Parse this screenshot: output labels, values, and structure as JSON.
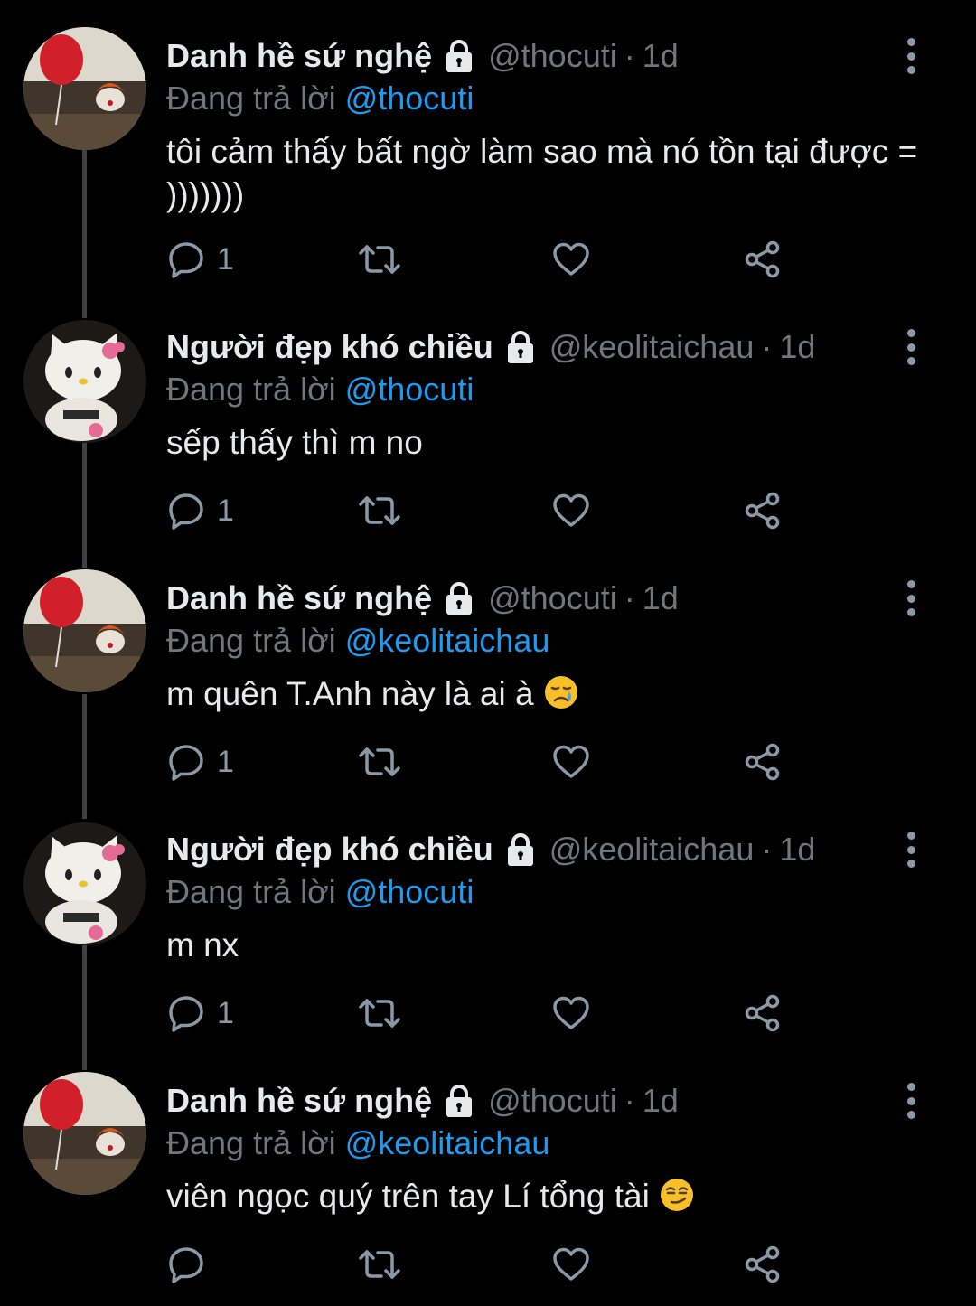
{
  "tweets": [
    {
      "name": "Danh hề sứ nghệ",
      "handle": "@thocuti",
      "separator": "·",
      "time": "1d",
      "replying_prefix": "Đang trả lời",
      "replying_to": "@thocuti",
      "text": "tôi cảm thấy bất ngờ làm sao mà nó tồn tại được = )))))))",
      "reply_count": "1",
      "avatar": "balloon-clown-avatar"
    },
    {
      "name": "Người đẹp khó chiều",
      "handle": "@keolitaichau",
      "separator": "·",
      "time": "1d",
      "replying_prefix": "Đang trả lời",
      "replying_to": "@thocuti",
      "text": "sếp thấy thì m no",
      "reply_count": "1",
      "avatar": "hello-kitty-avatar"
    },
    {
      "name": "Danh hề sứ nghệ",
      "handle": "@thocuti",
      "separator": "·",
      "time": "1d",
      "replying_prefix": "Đang trả lời",
      "replying_to": "@keolitaichau",
      "text": "m quên T.Anh này là ai à",
      "emoji": "sad-face-emoji",
      "reply_count": "1",
      "avatar": "balloon-clown-avatar"
    },
    {
      "name": "Người đẹp khó chiều",
      "handle": "@keolitaichau",
      "separator": "·",
      "time": "1d",
      "replying_prefix": "Đang trả lời",
      "replying_to": "@thocuti",
      "text": "m nx",
      "reply_count": "1",
      "avatar": "hello-kitty-avatar"
    },
    {
      "name": "Danh hề sứ nghệ",
      "handle": "@thocuti",
      "separator": "·",
      "time": "1d",
      "replying_prefix": "Đang trả lời",
      "replying_to": "@keolitaichau",
      "text": "viên ngọc quý trên tay Lí tổng tài",
      "emoji": "smirk-face-emoji",
      "reply_count": "",
      "avatar": "balloon-clown-avatar"
    }
  ],
  "colors": {
    "background": "#000000",
    "text": "#e7e9ea",
    "secondary": "#71767b",
    "mention": "#1d9bf0",
    "icon": "#8b98a5",
    "thread_line": "#3e4144"
  },
  "icons": {
    "lock": "lock-icon",
    "more": "more-vertical-icon",
    "reply": "reply-icon",
    "retweet": "retweet-icon",
    "like": "heart-icon",
    "share": "share-icon"
  }
}
